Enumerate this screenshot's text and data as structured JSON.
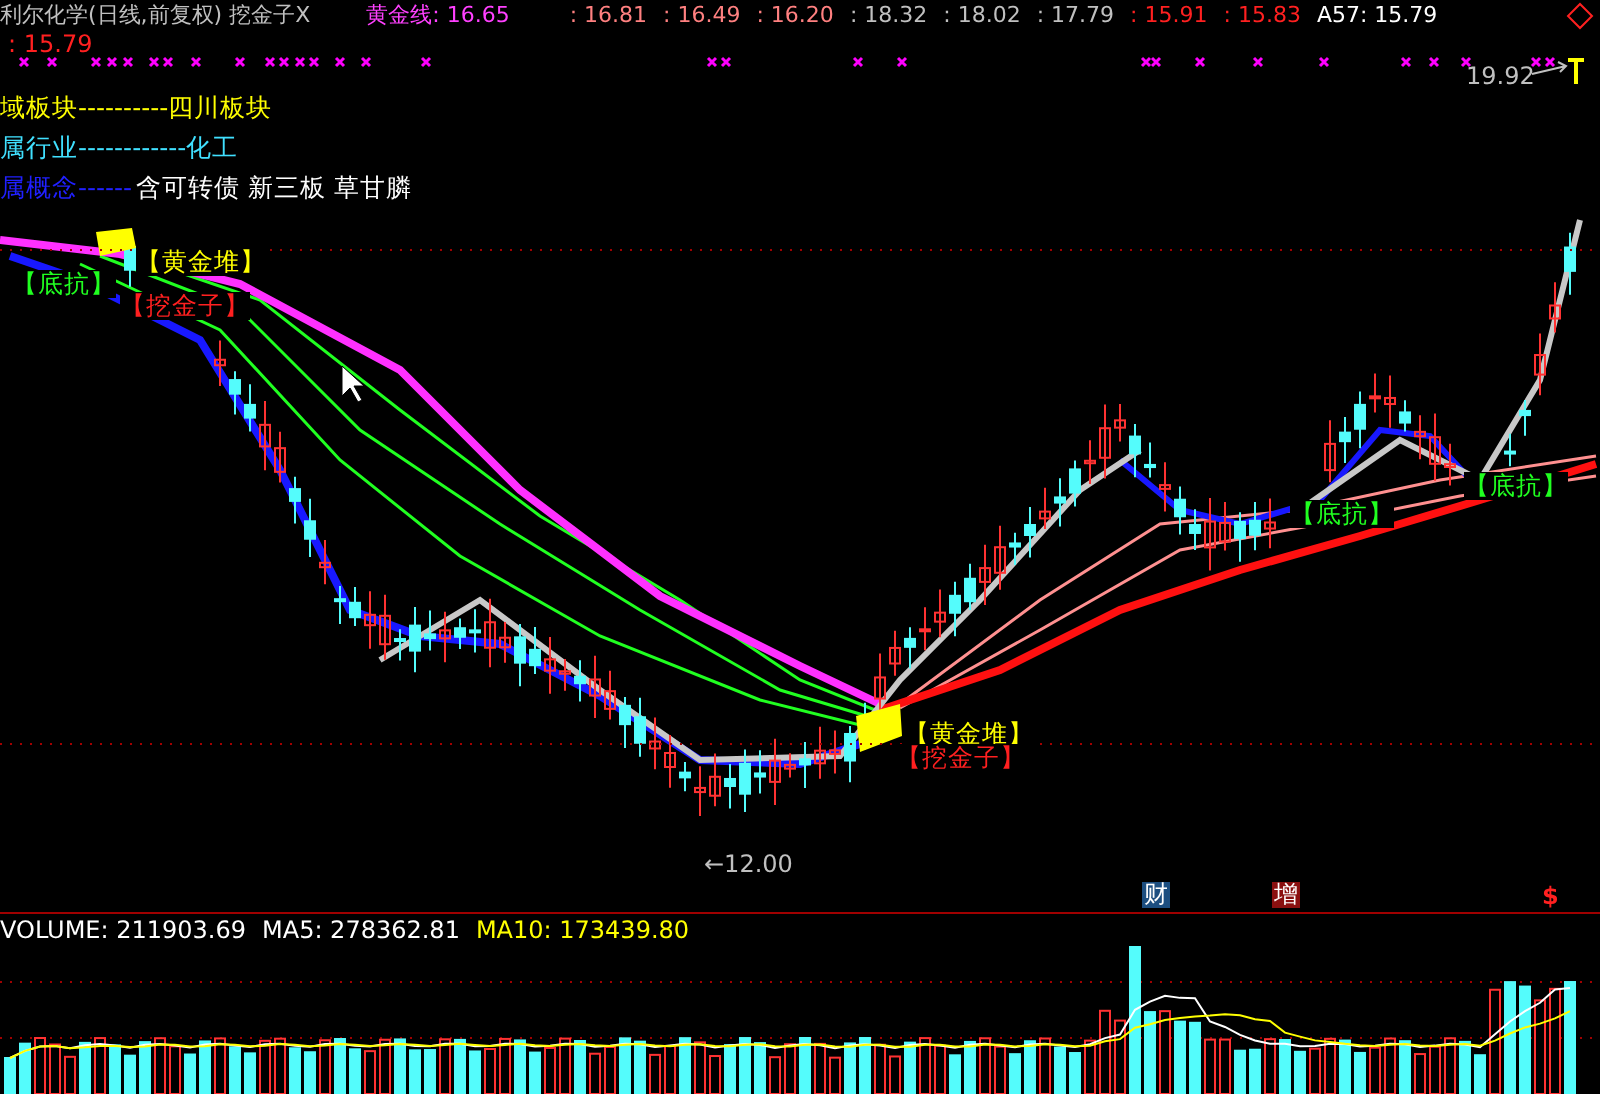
{
  "title": {
    "text": "利尔化学(日线,前复权) 挖金子X"
  },
  "indicators": [
    {
      "text": "黄金线: 16.65",
      "color": "#ff40ff"
    },
    {
      "text": ": 16.81",
      "color": "#ff8080"
    },
    {
      "text": ": 16.49",
      "color": "#ff8080"
    },
    {
      "text": ": 16.20",
      "color": "#ff8080"
    },
    {
      "text": ": 18.32",
      "color": "#c0c0c0"
    },
    {
      "text": ": 18.02",
      "color": "#c0c0c0"
    },
    {
      "text": ": 17.79",
      "color": "#c0c0c0"
    },
    {
      "text": ": 15.91",
      "color": "#ff2020"
    },
    {
      "text": ": 15.83",
      "color": "#ff2020"
    },
    {
      "text": "A57: 15.79",
      "color": "#ffffff"
    }
  ],
  "second_line": {
    "text": ": 15.79"
  },
  "info_lines": [
    {
      "text": "域板块----------四川板块",
      "color": "#ffff00"
    },
    {
      "text": "属行业------------化工",
      "color": "#40e0ff"
    },
    {
      "text": "属概念------",
      "color": "#2020ff"
    }
  ],
  "concepts": "含可转债 新三板 草甘膦",
  "chart": {
    "high": "19.92",
    "low": "←12.00",
    "labels": [
      {
        "text": "【黄金堆】",
        "kind": "gold"
      },
      {
        "text": "【挖金子】",
        "kind": "dig"
      },
      {
        "text": "【底抗】",
        "kind": "support"
      },
      {
        "text": "【黄金堆】",
        "kind": "gold"
      },
      {
        "text": "【挖金子】",
        "kind": "dig"
      },
      {
        "text": "【底抗】",
        "kind": "support"
      },
      {
        "text": "【底抗】",
        "kind": "support"
      }
    ],
    "events": [
      {
        "text": "财",
        "color": "#1c4e80"
      },
      {
        "text": "增",
        "color": "#8a1010"
      },
      {
        "text": "$",
        "color": "#000000"
      }
    ]
  },
  "volume": {
    "items": [
      {
        "text": "VOLUME: 211903.69",
        "color": "#ffffff"
      },
      {
        "text": "MA5: 278362.81",
        "color": "#ffffff"
      },
      {
        "text": "MA10: 173439.80",
        "color": "#ffff00"
      }
    ]
  }
}
